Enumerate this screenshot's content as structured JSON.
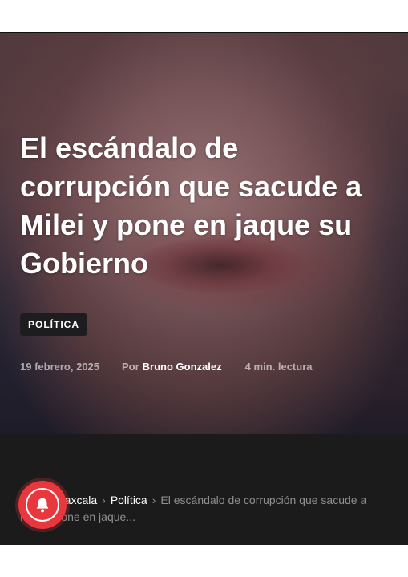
{
  "article": {
    "title": "El escándalo de corrupción que sacude a Milei y pone en jaque su Gobierno",
    "category": "POLÍTICA",
    "date": "19 febrero, 2025",
    "author_prefix": "Por",
    "author": "Bruno Gonzalez",
    "read_time": "4 min. lectura"
  },
  "breadcrumb": {
    "home": "Tlaxcala",
    "section": "Política",
    "current": "El escándalo de corrupción que sacude a Milei y pone en jaque..."
  },
  "notification_button": {
    "icon": "bell-icon"
  },
  "colors": {
    "accent": "#e8383e",
    "dark_band": "#1b1b1b",
    "badge": "#1d1d1f"
  }
}
